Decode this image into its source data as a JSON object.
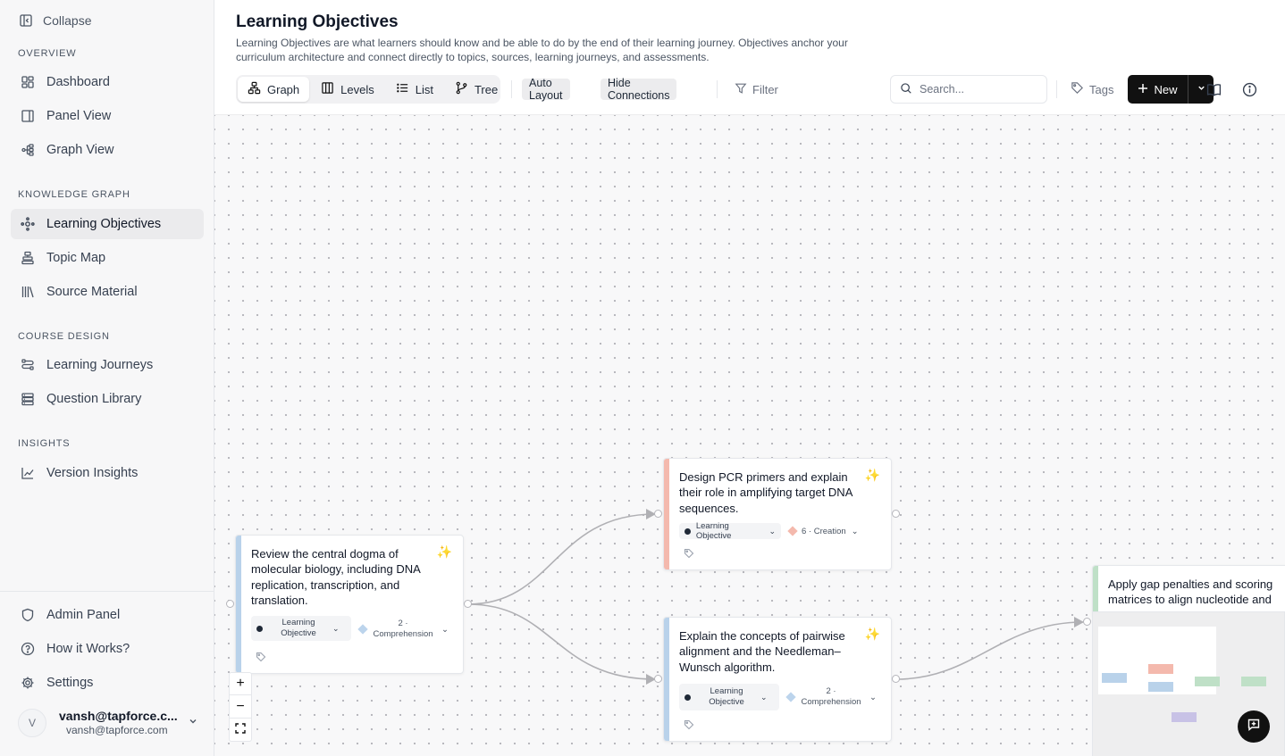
{
  "sidebar": {
    "collapse_label": "Collapse",
    "sections": {
      "overview": "OVERVIEW",
      "knowledge_graph": "KNOWLEDGE GRAPH",
      "course_design": "COURSE DESIGN",
      "insights": "INSIGHTS"
    },
    "items": {
      "dashboard": "Dashboard",
      "panel_view": "Panel View",
      "graph_view": "Graph View",
      "learning_objectives": "Learning Objectives",
      "topic_map": "Topic Map",
      "source_material": "Source Material",
      "learning_journeys": "Learning Journeys",
      "question_library": "Question Library",
      "version_insights": "Version Insights",
      "admin_panel": "Admin Panel",
      "how_it_works": "How it Works?",
      "settings": "Settings"
    },
    "user": {
      "avatar_initial": "V",
      "name": "vansh@tapforce.c...",
      "email": "vansh@tapforce.com"
    }
  },
  "header": {
    "title": "Learning Objectives",
    "description": "Learning Objectives are what learners should know and be able to do by the end of their learning journey. Objectives anchor your curriculum architecture and connect directly to topics, sources, learning journeys, and assessments."
  },
  "toolbar": {
    "tabs": [
      "Graph",
      "Levels",
      "List",
      "Tree"
    ],
    "active_tab": "Graph",
    "auto_layout": "Auto Layout",
    "hide_connections": "Hide Connections",
    "filter": "Filter",
    "search_placeholder": "Search...",
    "tags": "Tags",
    "new": "New"
  },
  "nodes": [
    {
      "text": "Review the central dogma of molecular biology, including DNA replication, transcription, and translation.",
      "type_label": "Learning Objective",
      "level_label": "2 · Comprehension",
      "accent": "#b9d2ea",
      "level_color": "#bcd4ec"
    },
    {
      "text": "Design PCR primers and explain their role in amplifying target DNA sequences.",
      "type_label": "Learning Objective",
      "level_label": "6 · Creation",
      "accent": "#f4b9ad",
      "level_color": "#f4b9ad"
    },
    {
      "text": "Explain the concepts of pairwise alignment and the Needleman–Wunsch algorithm.",
      "type_label": "Learning Objective",
      "level_label": "2 · Comprehension",
      "accent": "#b9d2ea",
      "level_color": "#bcd4ec"
    },
    {
      "text": "Apply gap penalties and scoring matrices to align nucleotide and",
      "accent": "#bfe0c7"
    }
  ],
  "colors": {
    "primary": "#111111",
    "edge": "#b0b0b4",
    "sparkle": "#e0a100"
  }
}
